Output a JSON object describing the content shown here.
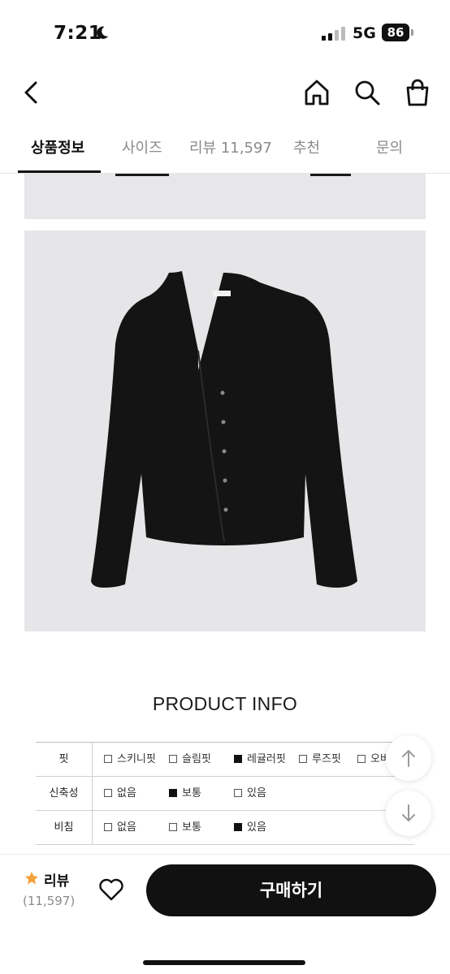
{
  "status_bar": {
    "time": "7:21",
    "network": "5G",
    "battery": "86"
  },
  "icons": {
    "moon": "moon-icon",
    "back": "chevron-left-icon",
    "home": "home-icon",
    "search": "search-icon",
    "bag": "shopping-bag-icon",
    "up": "arrow-up-icon",
    "down": "arrow-down-icon",
    "star": "star-icon",
    "heart": "heart-icon"
  },
  "tabs": [
    {
      "label": "상품정보",
      "active": true
    },
    {
      "label": "사이즈",
      "active": false
    },
    {
      "label": "리뷰 11,597",
      "active": false
    },
    {
      "label": "추천",
      "active": false
    },
    {
      "label": "문의",
      "active": false
    }
  ],
  "product_info": {
    "title": "PRODUCT INFO",
    "rows": [
      {
        "label": "핏",
        "options": [
          {
            "text": "스키니핏",
            "checked": false
          },
          {
            "text": "슬림핏",
            "checked": false
          },
          {
            "text": "레귤러핏",
            "checked": true
          },
          {
            "text": "루즈핏",
            "checked": false
          },
          {
            "text": "오버",
            "checked": false
          }
        ]
      },
      {
        "label": "신축성",
        "options": [
          {
            "text": "없음",
            "checked": false
          },
          {
            "text": "보통",
            "checked": true
          },
          {
            "text": "있음",
            "checked": false
          }
        ]
      },
      {
        "label": "비침",
        "options": [
          {
            "text": "없음",
            "checked": false
          },
          {
            "text": "보통",
            "checked": false
          },
          {
            "text": "있음",
            "checked": true
          }
        ]
      }
    ]
  },
  "bottom_bar": {
    "review_label": "리뷰",
    "review_count": "(11,597)",
    "buy_label": "구매하기"
  },
  "colors": {
    "accent": "#111111",
    "star": "#f2a13a",
    "photo_bg": "#e6e6e8",
    "inactive_tab": "#8a8a8a"
  }
}
